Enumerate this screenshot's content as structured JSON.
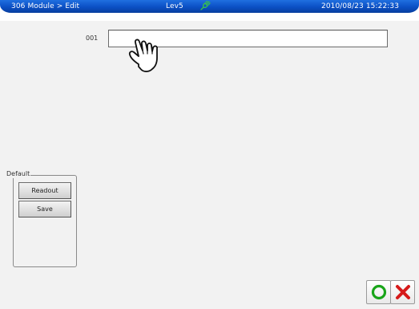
{
  "title_bar": {
    "breadcrumb": "306 Module > Edit",
    "level": "Lev5",
    "connection_icon": "plug-icon",
    "datetime": "2010/08/23 15:22:33"
  },
  "record": {
    "label": "001",
    "value": "",
    "placeholder": ""
  },
  "default_group": {
    "legend": "Default",
    "readout_label": "Readout",
    "save_label": "Save"
  },
  "actions": {
    "ok_icon": "circle-ok-icon",
    "cancel_icon": "x-cancel-icon",
    "ok_color": "#1aa51a",
    "cancel_color": "#d61a1a"
  },
  "cursor_icon": "hand-pointer-icon",
  "colors": {
    "title_bar": "#0b4fc4",
    "background": "#f2f2f2"
  }
}
